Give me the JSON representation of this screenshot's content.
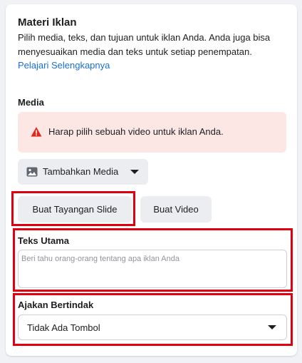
{
  "section": {
    "title": "Materi Iklan",
    "description": "Pilih media, teks, dan tujuan untuk iklan Anda. Anda juga bisa menyesuaikan media dan teks untuk setiap penempatan.",
    "learn_more": "Pelajari Selengkapnya"
  },
  "media": {
    "label": "Media",
    "alert_text": "Harap pilih sebuah video untuk iklan Anda.",
    "add_media_label": "Tambahkan Media",
    "slideshow_label": "Buat Tayangan Slide",
    "video_label": "Buat Video"
  },
  "primary_text": {
    "label": "Teks Utama",
    "placeholder": "Beri tahu orang-orang tentang apa iklan Anda"
  },
  "cta": {
    "label": "Ajakan Bertindak",
    "selected": "Tidak Ada Tombol"
  },
  "colors": {
    "highlight": "#e0000f",
    "alert_bg": "#fde7e5",
    "link": "#1a6ed8"
  },
  "icons": [
    "warning-icon",
    "image-icon",
    "caret-down-icon"
  ]
}
